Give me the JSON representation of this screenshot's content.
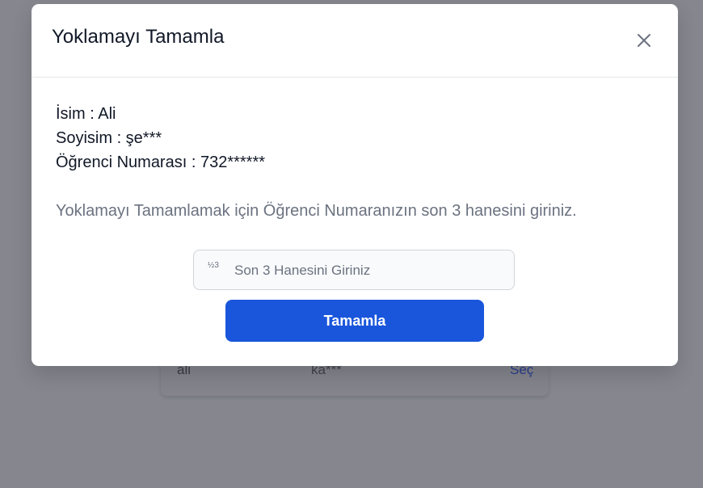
{
  "background_table": {
    "row": {
      "name": "ali",
      "surname": "ka***",
      "action": "Seç"
    }
  },
  "modal": {
    "title": "Yoklamayı Tamamla",
    "close_icon": "close-icon",
    "student": {
      "name_line": "İsim : Ali",
      "surname_line": "Soyisim : şe***",
      "number_line": "Öğrenci Numarası : 732******"
    },
    "instruction": "Yoklamayı Tamamlamak için Öğrenci Numaranızın son 3 hanesini giriniz.",
    "input": {
      "icon": "number-icon",
      "icon_text": "½3",
      "placeholder": "Son 3 Hanesini Giriniz",
      "value": ""
    },
    "submit_label": "Tamamla"
  },
  "colors": {
    "overlay": "#85868e",
    "primary_button": "#1a56db",
    "modal_bg": "#ffffff"
  }
}
